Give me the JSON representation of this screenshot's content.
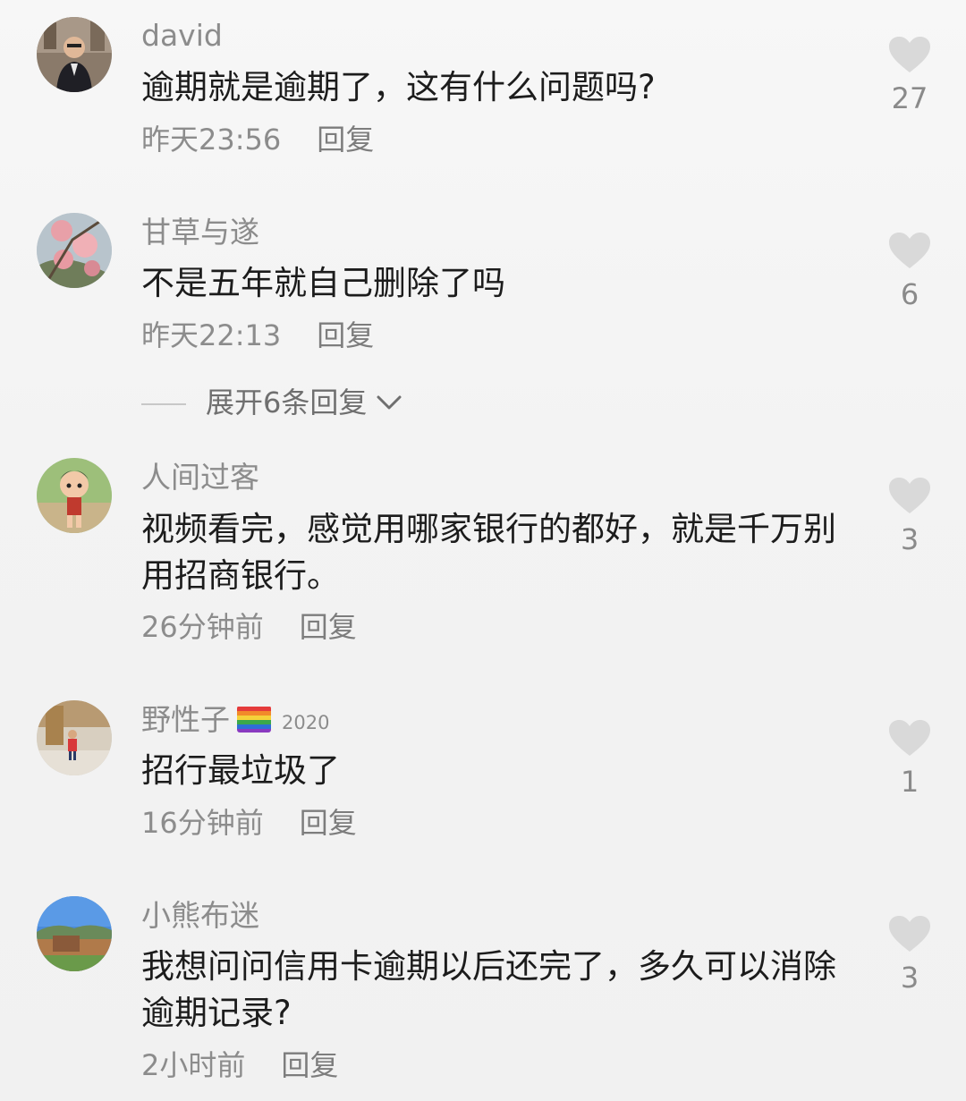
{
  "comments": [
    {
      "username": "david",
      "text": "逾期就是逾期了，这有什么问题吗?",
      "time": "昨天23:56",
      "reply_label": "回复",
      "likes": "27",
      "avatar_icon": "person-photo-avatar"
    },
    {
      "username": "甘草与遂",
      "text": "不是五年就自己删除了吗",
      "time": "昨天22:13",
      "reply_label": "回复",
      "likes": "6",
      "avatar_icon": "flower-photo-avatar"
    },
    {
      "username": "人间过客",
      "text": "视频看完，感觉用哪家银行的都好，就是千万别用招商银行。",
      "time": "26分钟前",
      "reply_label": "回复",
      "likes": "3",
      "avatar_icon": "cartoon-figure-avatar"
    },
    {
      "username": "野性子",
      "badge_year": "2020",
      "text": "招行最垃圾了",
      "time": "16分钟前",
      "reply_label": "回复",
      "likes": "1",
      "avatar_icon": "person-photo-avatar"
    },
    {
      "username": "小熊布迷",
      "text": "我想问问信用卡逾期以后还完了，多久可以消除逾期记录?",
      "time": "2小时前",
      "reply_label": "回复",
      "likes": "3",
      "avatar_icon": "landscape-photo-avatar"
    }
  ],
  "expand_replies": {
    "label": "展开6条回复"
  },
  "colors": {
    "background": "#f4f4f4",
    "username": "#8c8c8c",
    "text": "#1c1c1c",
    "heart": "#d9d9d9"
  },
  "icons": {
    "like": "heart-icon",
    "expand": "chevron-down-icon",
    "badge": "rainbow-flag-icon"
  }
}
